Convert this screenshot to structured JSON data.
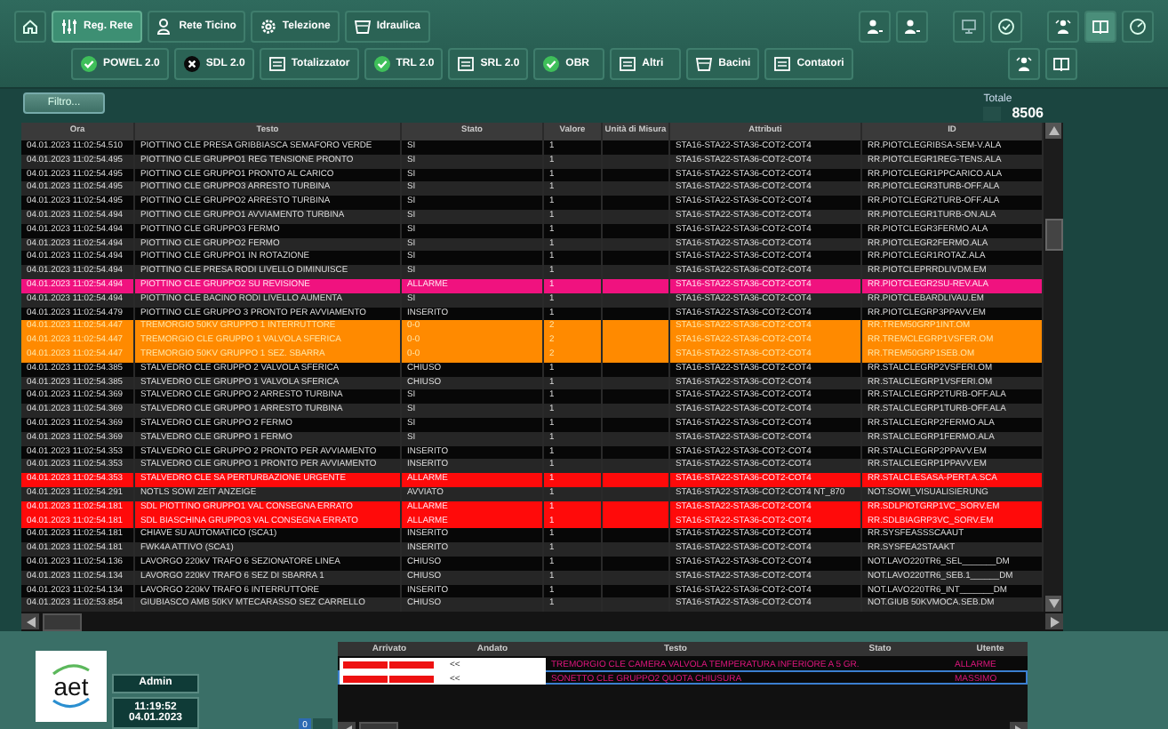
{
  "toolbar": {
    "tabs": [
      {
        "label": "Reg. Rete",
        "selected": true,
        "kind": "sliders"
      },
      {
        "label": "Rete Ticino",
        "selected": false,
        "kind": "person"
      },
      {
        "label": "Telezione",
        "selected": false,
        "kind": "gear"
      },
      {
        "label": "Idraulica",
        "selected": false,
        "kind": "basin"
      }
    ],
    "systems": [
      {
        "label": "POWEL 2.0",
        "kind": "ok"
      },
      {
        "label": "SDL 2.0",
        "kind": "error"
      },
      {
        "label": "Totalizzator",
        "kind": "doc"
      },
      {
        "label": "TRL 2.0",
        "kind": "ok"
      },
      {
        "label": "SRL 2.0",
        "kind": "doc"
      },
      {
        "label": "OBR",
        "kind": "ok"
      },
      {
        "label": "Altri",
        "kind": "doc"
      },
      {
        "label": "Bacini",
        "kind": "basin"
      },
      {
        "label": "Contatori",
        "kind": "doc"
      }
    ]
  },
  "filter_button": "Filtro...",
  "total": {
    "label": "Totale",
    "value": "8506"
  },
  "table": {
    "columns": [
      "Ora",
      "Testo",
      "Stato",
      "Valore",
      "Unità di Misura",
      "Attributi",
      "ID"
    ],
    "rows": [
      {
        "cells": [
          "04.01.2023 11:02:54.510",
          "PIOTTINO CLE PRESA GRIBBIASCA SEMAFORO VERDE",
          "SI",
          "1",
          "",
          "STA16-STA22-STA36-COT2-COT4",
          "RR.PIOTCLEGRIBSA-SEM-V.ALA"
        ]
      },
      {
        "cells": [
          "04.01.2023 11:02:54.495",
          "PIOTTINO CLE GRUPPO1 REG TENSIONE PRONTO",
          "SI",
          "1",
          "",
          "STA16-STA22-STA36-COT2-COT4",
          "RR.PIOTCLEGR1REG-TENS.ALA"
        ]
      },
      {
        "cells": [
          "04.01.2023 11:02:54.495",
          "PIOTTINO CLE GRUPPO1 PRONTO AL CARICO",
          "SI",
          "1",
          "",
          "STA16-STA22-STA36-COT2-COT4",
          "RR.PIOTCLEGR1PPCARICO.ALA"
        ]
      },
      {
        "cells": [
          "04.01.2023 11:02:54.495",
          "PIOTTINO CLE GRUPPO3 ARRESTO TURBINA",
          "SI",
          "1",
          "",
          "STA16-STA22-STA36-COT2-COT4",
          "RR.PIOTCLEGR3TURB-OFF.ALA"
        ]
      },
      {
        "cells": [
          "04.01.2023 11:02:54.495",
          "PIOTTINO CLE GRUPPO2 ARRESTO TURBINA",
          "SI",
          "1",
          "",
          "STA16-STA22-STA36-COT2-COT4",
          "RR.PIOTCLEGR2TURB-OFF.ALA"
        ]
      },
      {
        "cells": [
          "04.01.2023 11:02:54.494",
          "PIOTTINO CLE GRUPPO1 AVVIAMENTO TURBINA",
          "SI",
          "1",
          "",
          "STA16-STA22-STA36-COT2-COT4",
          "RR.PIOTCLEGR1TURB-ON.ALA"
        ]
      },
      {
        "cells": [
          "04.01.2023 11:02:54.494",
          "PIOTTINO CLE GRUPPO3 FERMO",
          "SI",
          "1",
          "",
          "STA16-STA22-STA36-COT2-COT4",
          "RR.PIOTCLEGR3FERMO.ALA"
        ]
      },
      {
        "cells": [
          "04.01.2023 11:02:54.494",
          "PIOTTINO CLE GRUPPO2 FERMO",
          "SI",
          "1",
          "",
          "STA16-STA22-STA36-COT2-COT4",
          "RR.PIOTCLEGR2FERMO.ALA"
        ]
      },
      {
        "cells": [
          "04.01.2023 11:02:54.494",
          "PIOTTINO CLE GRUPPO1 IN ROTAZIONE",
          "SI",
          "1",
          "",
          "STA16-STA22-STA36-COT2-COT4",
          "RR.PIOTCLEGR1ROTAZ.ALA"
        ]
      },
      {
        "cells": [
          "04.01.2023 11:02:54.494",
          "PIOTTINO CLE PRESA RODI LIVELLO DIMINUISCE",
          "SI",
          "1",
          "",
          "STA16-STA22-STA36-COT2-COT4",
          "RR.PIOTCLEPRRDLIVDM.EM"
        ]
      },
      {
        "cells": [
          "04.01.2023 11:02:54.494",
          "PIOTTINO CLE GRUPPO2 SU REVISIONE",
          "ALLARME",
          "1",
          "",
          "STA16-STA22-STA36-COT2-COT4",
          "RR.PIOTCLEGR2SU-REV.ALA"
        ],
        "color": "#f0127f"
      },
      {
        "cells": [
          "04.01.2023 11:02:54.494",
          "PIOTTINO CLE BACINO RODI LIVELLO AUMENTA",
          "SI",
          "1",
          "",
          "STA16-STA22-STA36-COT2-COT4",
          "RR.PIOTCLEBARDLIVAU.EM"
        ]
      },
      {
        "cells": [
          "04.01.2023 11:02:54.479",
          "PIOTTINO CLE GRUPPO 3 PRONTO PER AVVIAMENTO",
          "INSERITO",
          "1",
          "",
          "STA16-STA22-STA36-COT2-COT4",
          "RR.PIOTCLEGRP3PPAVV.EM"
        ]
      },
      {
        "cells": [
          "04.01.2023 11:02:54.447",
          "TREMORGIO 50KV GRUPPO 1 INTERRUTTORE",
          "0-0",
          "2",
          "",
          "STA16-STA22-STA36-COT2-COT4",
          "RR.TREM50GRP1INT.OM"
        ],
        "color": "#ff8a00"
      },
      {
        "cells": [
          "04.01.2023 11:02:54.447",
          "TREMORGIO CLE GRUPPO 1 VALVOLA SFERICA",
          "0-0",
          "2",
          "",
          "STA16-STA22-STA36-COT2-COT4",
          "RR.TREMCLEGRP1VSFER.OM"
        ],
        "color": "#ff8a00"
      },
      {
        "cells": [
          "04.01.2023 11:02:54.447",
          "TREMORGIO 50KV GRUPPO 1 SEZ. SBARRA",
          "0-0",
          "2",
          "",
          "STA16-STA22-STA36-COT2-COT4",
          "RR.TREM50GRP1SEB.OM"
        ],
        "color": "#ff8a00"
      },
      {
        "cells": [
          "04.01.2023 11:02:54.385",
          "STALVEDRO CLE GRUPPO 2 VALVOLA SFERICA",
          "CHIUSO",
          "1",
          "",
          "STA16-STA22-STA36-COT2-COT4",
          "RR.STALCLEGRP2VSFERI.OM"
        ]
      },
      {
        "cells": [
          "04.01.2023 11:02:54.385",
          "STALVEDRO CLE GRUPPO 1 VALVOLA SFERICA",
          "CHIUSO",
          "1",
          "",
          "STA16-STA22-STA36-COT2-COT4",
          "RR.STALCLEGRP1VSFERI.OM"
        ]
      },
      {
        "cells": [
          "04.01.2023 11:02:54.369",
          "STALVEDRO CLE GRUPPO 2 ARRESTO TURBINA",
          "SI",
          "1",
          "",
          "STA16-STA22-STA36-COT2-COT4",
          "RR.STALCLEGRP2TURB-OFF.ALA"
        ]
      },
      {
        "cells": [
          "04.01.2023 11:02:54.369",
          "STALVEDRO CLE GRUPPO 1 ARRESTO TURBINA",
          "SI",
          "1",
          "",
          "STA16-STA22-STA36-COT2-COT4",
          "RR.STALCLEGRP1TURB-OFF.ALA"
        ]
      },
      {
        "cells": [
          "04.01.2023 11:02:54.369",
          "STALVEDRO CLE GRUPPO 2 FERMO",
          "SI",
          "1",
          "",
          "STA16-STA22-STA36-COT2-COT4",
          "RR.STALCLEGRP2FERMO.ALA"
        ]
      },
      {
        "cells": [
          "04.01.2023 11:02:54.369",
          "STALVEDRO CLE GRUPPO 1 FERMO",
          "SI",
          "1",
          "",
          "STA16-STA22-STA36-COT2-COT4",
          "RR.STALCLEGRP1FERMO.ALA"
        ]
      },
      {
        "cells": [
          "04.01.2023 11:02:54.353",
          "STALVEDRO CLE GRUPPO 2 PRONTO PER AVVIAMENTO",
          "INSERITO",
          "1",
          "",
          "STA16-STA22-STA36-COT2-COT4",
          "RR.STALCLEGRP2PPAVV.EM"
        ]
      },
      {
        "cells": [
          "04.01.2023 11:02:54.353",
          "STALVEDRO CLE GRUPPO 1 PRONTO PER AVVIAMENTO",
          "INSERITO",
          "1",
          "",
          "STA16-STA22-STA36-COT2-COT4",
          "RR.STALCLEGRP1PPAVV.EM"
        ]
      },
      {
        "cells": [
          "04.01.2023 11:02:54.353",
          "STALVEDRO CLE SA PERTURBAZIONE URGENTE",
          "ALLARME",
          "1",
          "",
          "STA16-STA22-STA36-COT2-COT4",
          "RR.STALCLESASA-PERT.A.SCA"
        ],
        "color": "#ff0a0a"
      },
      {
        "cells": [
          "04.01.2023 11:02:54.291",
          "NOTLS SOWI ZEIT ANZEIGE",
          "AVVIATO",
          "1",
          "",
          "STA16-STA22-STA36-COT2-COT4 NT_870",
          "NOT.SOWI_VISUALISIERUNG"
        ]
      },
      {
        "cells": [
          "04.01.2023 11:02:54.181",
          "SDL PIOTTINO GRUPPO1 VAL CONSEGNA ERRATO",
          "ALLARME",
          "1",
          "",
          "STA16-STA22-STA36-COT2-COT4",
          "RR.SDLPIOTGRP1VC_SORV.EM"
        ],
        "color": "#ff0a0a"
      },
      {
        "cells": [
          "04.01.2023 11:02:54.181",
          "SDL BIASCHINA GRUPPO3 VAL CONSEGNA ERRATO",
          "ALLARME",
          "1",
          "",
          "STA16-STA22-STA36-COT2-COT4",
          "RR.SDLBIAGRP3VC_SORV.EM"
        ],
        "color": "#ff0a0a"
      },
      {
        "cells": [
          "04.01.2023 11:02:54.181",
          "CHIAVE SU AUTOMATICO (SCA1)",
          "INSERITO",
          "1",
          "",
          "STA16-STA22-STA36-COT2-COT4",
          "RR.SYSFEASSSCAAUT"
        ]
      },
      {
        "cells": [
          "04.01.2023 11:02:54.181",
          "FWK4A ATTIVO (SCA1)",
          "INSERITO",
          "1",
          "",
          "STA16-STA22-STA36-COT2-COT4",
          "RR.SYSFEA2STAAKT"
        ]
      },
      {
        "cells": [
          "04.01.2023 11:02:54.136",
          "LAVORGO 220kV TRAFO 6 SEZIONATORE LINEA",
          "CHIUSO",
          "1",
          "",
          "STA16-STA22-STA36-COT2-COT4",
          "NOT.LAVO220TR6_SEL_______DM"
        ]
      },
      {
        "cells": [
          "04.01.2023 11:02:54.134",
          "LAVORGO 220kV TRAFO 6 SEZ DI SBARRA 1",
          "CHIUSO",
          "1",
          "",
          "STA16-STA22-STA36-COT2-COT4",
          "NOT.LAVO220TR6_SEB.1______DM"
        ]
      },
      {
        "cells": [
          "04.01.2023 11:02:54.134",
          "LAVORGO 220kV TRAFO 6 INTERRUTTORE",
          "INSERITO",
          "1",
          "",
          "STA16-STA22-STA36-COT2-COT4",
          "NOT.LAVO220TR6_INT_______DM"
        ]
      },
      {
        "cells": [
          "04.01.2023 11:02:53.854",
          "GIUBIASCO AMB 50KV MTECARASSO SEZ CARRELLO",
          "CHIUSO",
          "1",
          "",
          "STA16-STA22-STA36-COT2-COT4",
          "NOT.GIUB 50KVMOCA.SEB.DM"
        ]
      }
    ]
  },
  "footer": {
    "logo": "aet",
    "user": "Admin",
    "time": "11:19:52",
    "date": "04.01.2023",
    "counter": "0",
    "alarms": {
      "columns": [
        "Arrivato",
        "Andato",
        "Testo",
        "Stato",
        "Utente"
      ],
      "rows": [
        {
          "andato": "<<",
          "text": "TREMORGIO CLE CAMERA VALVOLA TEMPERATURA INFERIORE A 5 GR.",
          "state": "ALLARME",
          "selected": false
        },
        {
          "andato": "<<",
          "text": "SONETTO CLE GRUPPO2 QUOTA CHIUSURA",
          "state": "MASSIMO",
          "selected": true
        }
      ]
    }
  }
}
